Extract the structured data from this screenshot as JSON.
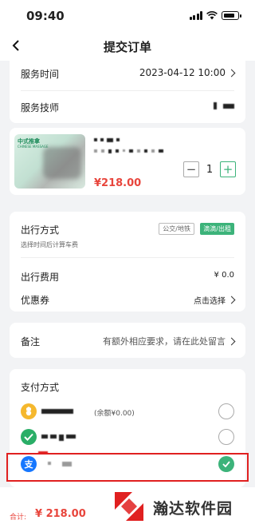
{
  "status_bar": {
    "time": "09:40"
  },
  "nav": {
    "title": "提交订单"
  },
  "service": {
    "time_label": "服务时间",
    "time_value": "2023-04-12 10:00",
    "tech_label": "服务技师"
  },
  "product": {
    "thumb_title": "中式推拿",
    "thumb_subtitle": "CHINESE MASSAGE",
    "price": "¥218.00",
    "quantity": "1",
    "minus": "−",
    "plus": "+"
  },
  "travel": {
    "label": "出行方式",
    "option_bus": "公交/地铁",
    "option_taxi": "滴滴/出租",
    "selected": "滴滴/出租",
    "hint": "选择时间后计算车费",
    "fee_label": "出行费用",
    "fee_value": "¥ 0.0",
    "coupon_label": "优惠券",
    "coupon_action": "点击选择"
  },
  "remark": {
    "label": "备注",
    "placeholder": "有额外相应要求，请在此处留言"
  },
  "payment": {
    "label": "支付方式",
    "balance_note": "(余额¥0.00)",
    "selected_index": 2,
    "methods": [
      {
        "icon": "balance-wallet-icon",
        "color": "#f5b82e"
      },
      {
        "icon": "wechat-pay-icon",
        "color": "#2aae67"
      },
      {
        "icon": "alipay-icon",
        "color": "#1677ff"
      }
    ]
  },
  "footer": {
    "total_label": "合计:",
    "total_value": "¥ 218.00",
    "watermark": "瀚达软件园"
  },
  "colors": {
    "accent_green": "#3cb37a",
    "price_red": "#e8453c",
    "highlight_red": "#e02020"
  }
}
